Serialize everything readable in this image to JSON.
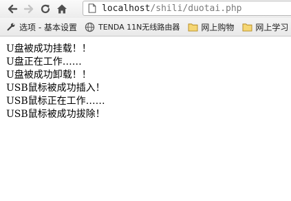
{
  "browser": {
    "url": {
      "host": "localhost",
      "path": "/shili/duotai.php"
    },
    "icons": {
      "back": "back-arrow-icon",
      "forward": "forward-arrow-icon",
      "reload": "reload-icon",
      "home": "home-icon",
      "page": "page-icon"
    }
  },
  "bookmarks": [
    {
      "icon": "wrench-icon",
      "label": "选项 - 基本设置"
    },
    {
      "icon": "globe-icon",
      "label": "TENDA 11N无线路由器"
    },
    {
      "icon": "folder-icon",
      "label": "网上购物"
    },
    {
      "icon": "folder-icon",
      "label": "网上学习"
    }
  ],
  "content": {
    "lines": [
      "U盘被成功挂载！！",
      "U盘正在工作……",
      "U盘被成功卸载！！",
      "USB鼠标被成功插入！",
      "USB鼠标正在工作……",
      "USB鼠标被成功拔除！"
    ]
  }
}
